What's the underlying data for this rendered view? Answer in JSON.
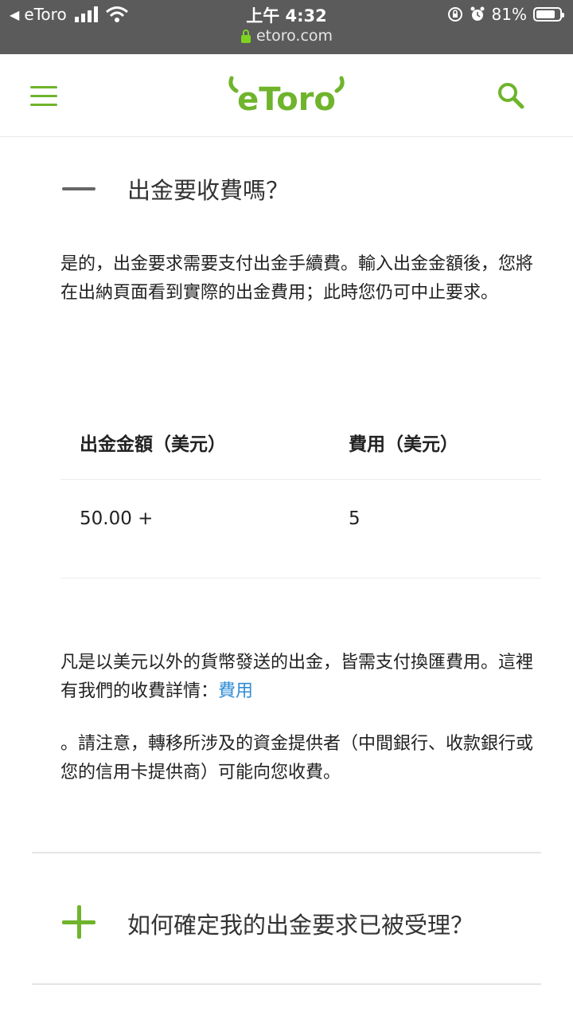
{
  "status_bar": {
    "back_app": "eToro",
    "time": "上午 4:32",
    "url": "etoro.com",
    "battery": "81%",
    "battery_level": 0.81
  },
  "header": {
    "logo_text": "eToro",
    "brand_color": "#6fb42c"
  },
  "faq_open": {
    "question": "出金要收費嗎？",
    "answer_intro": "是的，出金要求需要支付出金手續費。輸入出金金額後，您將在出納頁面看到實際的出金費用；此時您仍可中止要求。",
    "table": {
      "headers": [
        "出金金額（美元）",
        "費用（美元）"
      ],
      "rows": [
        [
          "50.00 +",
          "5"
        ]
      ]
    },
    "note1_text": "凡是以美元以外的貨幣發送的出金，皆需支付換匯費用。這裡有我們的收費詳情：",
    "note1_link": "費用",
    "note2": "。請注意，轉移所涉及的資金提供者（中間銀行、收款銀行或您的信用卡提供商）可能向您收費。"
  },
  "faq_closed": {
    "question": "如何確定我的出金要求已被受理？"
  },
  "colors": {
    "link": "#2f8dd6",
    "status_bar_bg": "#5b5b5b"
  }
}
